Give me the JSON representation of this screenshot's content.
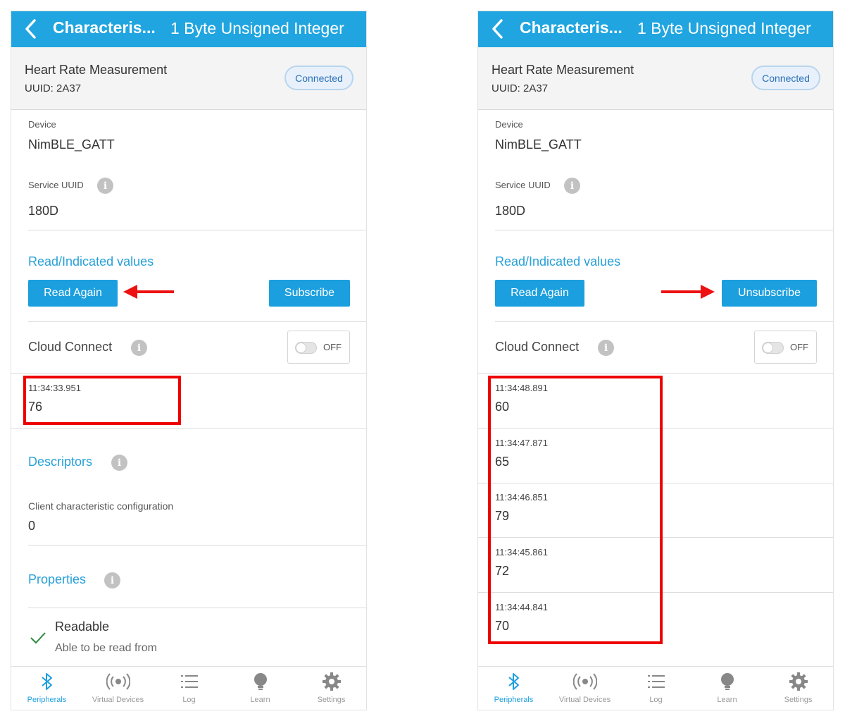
{
  "screens": {
    "left": {
      "appbar": {
        "title": "Characteris...",
        "subtitle": "1 Byte Unsigned Integer"
      },
      "characteristic": {
        "name": "Heart Rate Measurement",
        "uuid": "UUID: 2A37",
        "status": "Connected"
      },
      "device": {
        "label": "Device",
        "value": "NimBLE_GATT"
      },
      "service": {
        "label": "Service UUID",
        "value": "180D"
      },
      "values_section": {
        "title": "Read/Indicated values",
        "read_button": "Read Again",
        "subscribe_button": "Subscribe"
      },
      "cloud": {
        "label": "Cloud Connect",
        "toggle": "OFF"
      },
      "readings": [
        {
          "time": "11:34:33.951",
          "value": "76"
        }
      ],
      "descriptors": {
        "title": "Descriptors",
        "name": "Client characteristic configuration",
        "value": "0"
      },
      "properties": {
        "title": "Properties",
        "item_title": "Readable",
        "item_desc": "Able to be read from"
      }
    },
    "right": {
      "appbar": {
        "title": "Characteris...",
        "subtitle": "1 Byte Unsigned Integer"
      },
      "characteristic": {
        "name": "Heart Rate Measurement",
        "uuid": "UUID: 2A37",
        "status": "Connected"
      },
      "device": {
        "label": "Device",
        "value": "NimBLE_GATT"
      },
      "service": {
        "label": "Service UUID",
        "value": "180D"
      },
      "values_section": {
        "title": "Read/Indicated values",
        "read_button": "Read Again",
        "subscribe_button": "Unsubscribe"
      },
      "cloud": {
        "label": "Cloud Connect",
        "toggle": "OFF"
      },
      "readings": [
        {
          "time": "11:34:48.891",
          "value": "60"
        },
        {
          "time": "11:34:47.871",
          "value": "65"
        },
        {
          "time": "11:34:46.851",
          "value": "79"
        },
        {
          "time": "11:34:45.861",
          "value": "72"
        },
        {
          "time": "11:34:44.841",
          "value": "70"
        }
      ]
    }
  },
  "tabs": [
    {
      "label": "Peripherals",
      "icon": "bluetooth-icon",
      "active": true
    },
    {
      "label": "Virtual Devices",
      "icon": "broadcast-icon",
      "active": false
    },
    {
      "label": "Log",
      "icon": "list-icon",
      "active": false
    },
    {
      "label": "Learn",
      "icon": "lightbulb-icon",
      "active": false
    },
    {
      "label": "Settings",
      "icon": "gear-icon",
      "active": false
    }
  ],
  "colors": {
    "accent": "#20a5e0",
    "highlight": "#ee0000",
    "tab_active": "#1c9fde"
  }
}
